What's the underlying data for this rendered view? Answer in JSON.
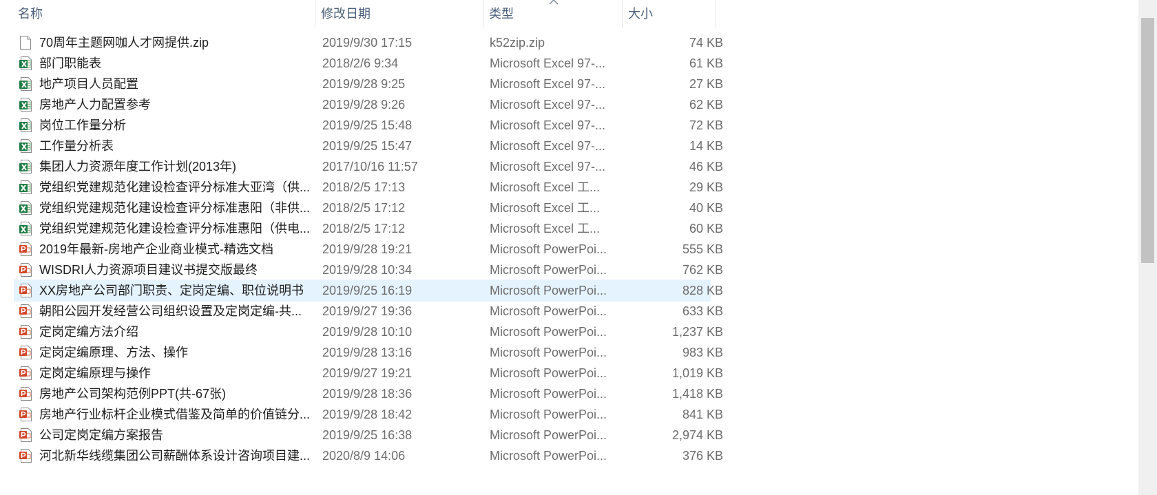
{
  "columns": {
    "name": "名称",
    "date": "修改日期",
    "type": "类型",
    "size": "大小"
  },
  "sort_column": "type",
  "selected_row_index": 12,
  "files": [
    {
      "icon": "zip-file-icon",
      "name": "70周年主题网咖人才网提供.zip",
      "date": "2019/9/30 17:15",
      "type": "k52zip.zip",
      "size": "74 KB"
    },
    {
      "icon": "excel-97-file-icon",
      "name": "部门职能表",
      "date": "2018/2/6 9:34",
      "type": "Microsoft Excel 97-...",
      "size": "61 KB"
    },
    {
      "icon": "excel-97-file-icon",
      "name": "地产项目人员配置",
      "date": "2019/9/28 9:25",
      "type": "Microsoft Excel 97-...",
      "size": "27 KB"
    },
    {
      "icon": "excel-97-file-icon",
      "name": "房地产人力配置参考",
      "date": "2019/9/28 9:26",
      "type": "Microsoft Excel 97-...",
      "size": "62 KB"
    },
    {
      "icon": "excel-97-file-icon",
      "name": "岗位工作量分析",
      "date": "2019/9/25 15:48",
      "type": "Microsoft Excel 97-...",
      "size": "72 KB"
    },
    {
      "icon": "excel-97-file-icon",
      "name": "工作量分析表",
      "date": "2019/9/25 15:47",
      "type": "Microsoft Excel 97-...",
      "size": "14 KB"
    },
    {
      "icon": "excel-97-file-icon",
      "name": "集团人力资源年度工作计划(2013年)",
      "date": "2017/10/16 11:57",
      "type": "Microsoft Excel 97-...",
      "size": "46 KB"
    },
    {
      "icon": "excel-worksheet-file-icon",
      "name": "党组织党建规范化建设检查评分标准大亚湾（供...",
      "date": "2018/2/5 17:13",
      "type": "Microsoft Excel 工...",
      "size": "29 KB"
    },
    {
      "icon": "excel-worksheet-file-icon",
      "name": "党组织党建规范化建设检查评分标准惠阳（非供...",
      "date": "2018/2/5 17:12",
      "type": "Microsoft Excel 工...",
      "size": "40 KB"
    },
    {
      "icon": "excel-worksheet-file-icon",
      "name": "党组织党建规范化建设检查评分标准惠阳（供电...",
      "date": "2018/2/5 17:12",
      "type": "Microsoft Excel 工...",
      "size": "60 KB"
    },
    {
      "icon": "powerpoint-file-icon",
      "name": "2019年最新-房地产企业商业模式-精选文档",
      "date": "2019/9/28 19:21",
      "type": "Microsoft PowerPoi...",
      "size": "555 KB"
    },
    {
      "icon": "powerpoint-file-icon",
      "name": "WISDRI人力资源项目建议书提交版最终",
      "date": "2019/9/28 10:34",
      "type": "Microsoft PowerPoi...",
      "size": "762 KB"
    },
    {
      "icon": "powerpoint-file-icon",
      "name": "XX房地产公司部门职责、定岗定编、职位说明书",
      "date": "2019/9/25 16:19",
      "type": "Microsoft PowerPoi...",
      "size": "828 KB"
    },
    {
      "icon": "powerpoint-file-icon",
      "name": "朝阳公园开发经营公司组织设置及定岗定编-共...",
      "date": "2019/9/27 19:36",
      "type": "Microsoft PowerPoi...",
      "size": "633 KB"
    },
    {
      "icon": "powerpoint-file-icon",
      "name": "定岗定编方法介绍",
      "date": "2019/9/28 10:10",
      "type": "Microsoft PowerPoi...",
      "size": "1,237 KB"
    },
    {
      "icon": "powerpoint-file-icon",
      "name": "定岗定编原理、方法、操作",
      "date": "2019/9/28 13:16",
      "type": "Microsoft PowerPoi...",
      "size": "983 KB"
    },
    {
      "icon": "powerpoint-file-icon",
      "name": "定岗定编原理与操作",
      "date": "2019/9/27 19:21",
      "type": "Microsoft PowerPoi...",
      "size": "1,019 KB"
    },
    {
      "icon": "powerpoint-file-icon",
      "name": "房地产公司架构范例PPT(共-67张)",
      "date": "2019/9/28 18:36",
      "type": "Microsoft PowerPoi...",
      "size": "1,418 KB"
    },
    {
      "icon": "powerpoint-file-icon",
      "name": "房地产行业标杆企业模式借鉴及简单的价值链分...",
      "date": "2019/9/28 18:42",
      "type": "Microsoft PowerPoi...",
      "size": "841 KB"
    },
    {
      "icon": "powerpoint-file-icon",
      "name": "公司定岗定编方案报告",
      "date": "2019/9/25 16:38",
      "type": "Microsoft PowerPoi...",
      "size": "2,974 KB"
    },
    {
      "icon": "powerpoint-file-icon",
      "name": "河北新华线缆集团公司薪酬体系设计咨询项目建...",
      "date": "2020/8/9 14:06",
      "type": "Microsoft PowerPoi...",
      "size": "376 KB"
    }
  ]
}
